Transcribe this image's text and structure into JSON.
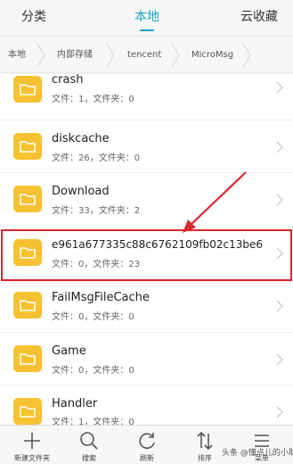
{
  "tabs": [
    {
      "label": "分类",
      "active": false
    },
    {
      "label": "本地",
      "active": true
    },
    {
      "label": "云收藏",
      "active": false
    }
  ],
  "breadcrumb": [
    "本地",
    "内部存储",
    "tencent",
    "MicroMsg"
  ],
  "files": [
    {
      "name": "crash",
      "meta": "文件：1，文件夹：0"
    },
    {
      "name": "diskcache",
      "meta": "文件：26，文件夹：0"
    },
    {
      "name": "Download",
      "meta": "文件：33，文件夹：2"
    },
    {
      "name": "e961a677335c88c6762109fb02c13be6",
      "meta": "文件：0，文件夹：23",
      "highlighted": true
    },
    {
      "name": "FailMsgFileCache",
      "meta": "文件：0，文件夹：0"
    },
    {
      "name": "Game",
      "meta": "文件：0，文件夹：0"
    },
    {
      "name": "Handler",
      "meta": "文件：1，文件夹：0"
    }
  ],
  "toolbar": [
    {
      "label": "新建文件夹",
      "icon": "plus-icon"
    },
    {
      "label": "搜索",
      "icon": "search-icon"
    },
    {
      "label": "刷新",
      "icon": "refresh-icon"
    },
    {
      "label": "排序",
      "icon": "sort-icon"
    },
    {
      "label": "菜单",
      "icon": "menu-icon"
    }
  ],
  "watermark": "头条 @懂点儿的小助手",
  "colors": {
    "accent": "#1aa3c2",
    "folder": "#f7c232",
    "highlight": "#d9272e"
  }
}
